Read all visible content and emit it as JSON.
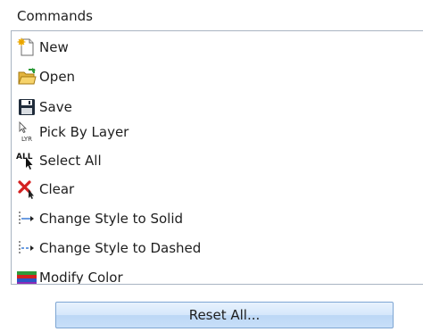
{
  "panel": {
    "heading": "Commands"
  },
  "commands": {
    "items": [
      {
        "label": "New",
        "icon": "new-document-icon"
      },
      {
        "label": "Open",
        "icon": "open-folder-icon"
      },
      {
        "label": "Save",
        "icon": "save-floppy-icon"
      },
      {
        "label": "Pick By Layer",
        "icon": "pick-by-layer-icon"
      },
      {
        "label": "Select All",
        "icon": "select-all-icon"
      },
      {
        "label": "Clear",
        "icon": "clear-icon"
      },
      {
        "label": "Change Style to Solid",
        "icon": "solid-line-style-icon"
      },
      {
        "label": "Change Style to Dashed",
        "icon": "dashed-line-style-icon"
      },
      {
        "label": "Modify Color",
        "icon": "modify-color-icon"
      }
    ]
  },
  "actions": {
    "reset_label": "Reset All..."
  },
  "icon_text": {
    "pick_by_layer": "LYR",
    "select_all": "ALL"
  },
  "colors": {
    "list_border": "#a9b4c2",
    "button_border": "#7ea6d3",
    "clear_red": "#d42020",
    "line_blue": "#3a7bd5"
  }
}
